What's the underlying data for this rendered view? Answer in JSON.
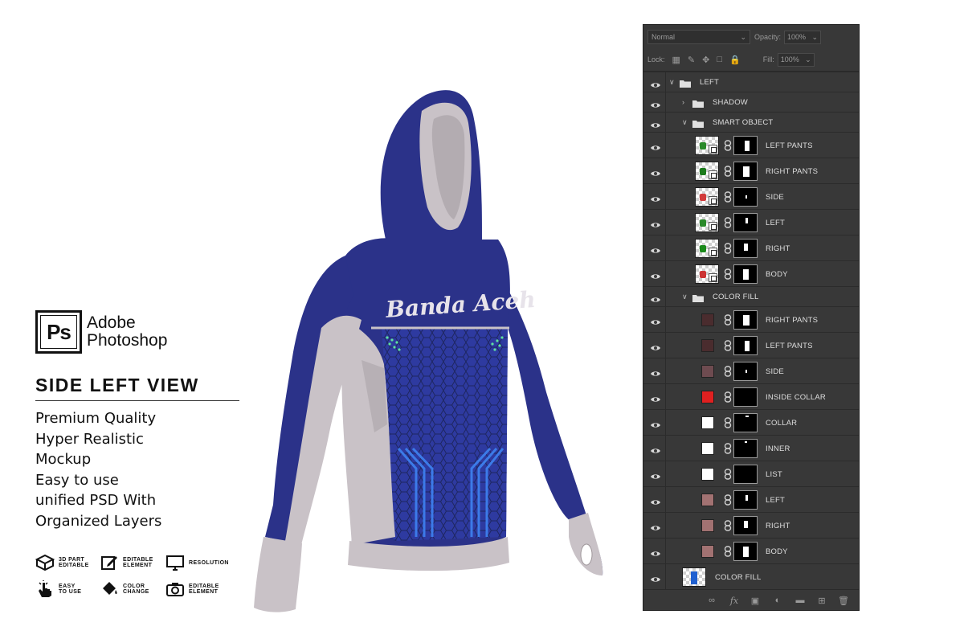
{
  "brand": {
    "logo_text": "Ps",
    "name_line1": "Adobe",
    "name_line2": "Photoshop"
  },
  "view_title": "SIDE LEFT VIEW",
  "features": [
    "Premium Quality",
    "Hyper Realistic",
    "Mockup",
    "Easy to use",
    "unified PSD With",
    "Organized Layers"
  ],
  "badges": [
    {
      "icon": "cube-icon",
      "text": "3D PART\nEDITABLE"
    },
    {
      "icon": "edit-icon",
      "text": "EDITABLE\nELEMENT"
    },
    {
      "icon": "monitor-icon",
      "text": "RESOLUTION"
    },
    {
      "icon": "hand-icon",
      "text": "EASY\nTO USE"
    },
    {
      "icon": "paint-bucket-icon",
      "text": "COLOR\nCHANGE"
    },
    {
      "icon": "camera-icon",
      "text": "EDITABLE\nELEMENT"
    }
  ],
  "product": {
    "print_text": "Banda Aceh",
    "body_color": "#2b3289",
    "trim_color": "#c9c2c7"
  },
  "panel": {
    "blend_mode": "Normal",
    "opacity_label": "Opacity:",
    "opacity_value": "100%",
    "lock_label": "Lock:",
    "fill_label": "Fill:",
    "fill_value": "100%",
    "layers": [
      {
        "name": "LEFT",
        "kind": "group",
        "expanded": true,
        "level": 0
      },
      {
        "name": "SHADOW",
        "kind": "group",
        "expanded": false,
        "level": 1
      },
      {
        "name": "SMART OBJECT",
        "kind": "group",
        "expanded": true,
        "level": 1
      },
      {
        "name": "LEFT PANTS",
        "kind": "smart",
        "level": 2
      },
      {
        "name": "RIGHT PANTS",
        "kind": "smart",
        "level": 2
      },
      {
        "name": "SIDE",
        "kind": "smart",
        "level": 2
      },
      {
        "name": "LEFT",
        "kind": "smart",
        "level": 2
      },
      {
        "name": "RIGHT",
        "kind": "smart",
        "level": 2
      },
      {
        "name": "BODY",
        "kind": "smart",
        "level": 2
      },
      {
        "name": "COLOR FILL",
        "kind": "group",
        "expanded": true,
        "level": 1
      },
      {
        "name": "RIGHT PANTS",
        "kind": "fill",
        "color": "#4a2c2e",
        "level": 2
      },
      {
        "name": "LEFT PANTS",
        "kind": "fill",
        "color": "#4a2c2e",
        "level": 2
      },
      {
        "name": "SIDE",
        "kind": "fill",
        "color": "#6e4b50",
        "level": 2
      },
      {
        "name": "INSIDE COLLAR",
        "kind": "fill",
        "color": "#e02020",
        "level": 2
      },
      {
        "name": "COLLAR",
        "kind": "fill",
        "color": "#ffffff",
        "level": 2
      },
      {
        "name": "INNER",
        "kind": "fill",
        "color": "#ffffff",
        "level": 2
      },
      {
        "name": "LIST",
        "kind": "fill",
        "color": "#ffffff",
        "level": 2
      },
      {
        "name": "LEFT",
        "kind": "fill",
        "color": "#a27272",
        "level": 2
      },
      {
        "name": "RIGHT",
        "kind": "fill",
        "color": "#a27272",
        "level": 2
      },
      {
        "name": "BODY",
        "kind": "fill",
        "color": "#a27272",
        "level": 2
      },
      {
        "name": "COLOR FILL",
        "kind": "image",
        "level": 0
      }
    ],
    "footer_icons": [
      "link-icon",
      "fx-icon",
      "mask-icon",
      "adjustment-icon",
      "folder-icon",
      "new-layer-icon",
      "trash-icon"
    ]
  }
}
